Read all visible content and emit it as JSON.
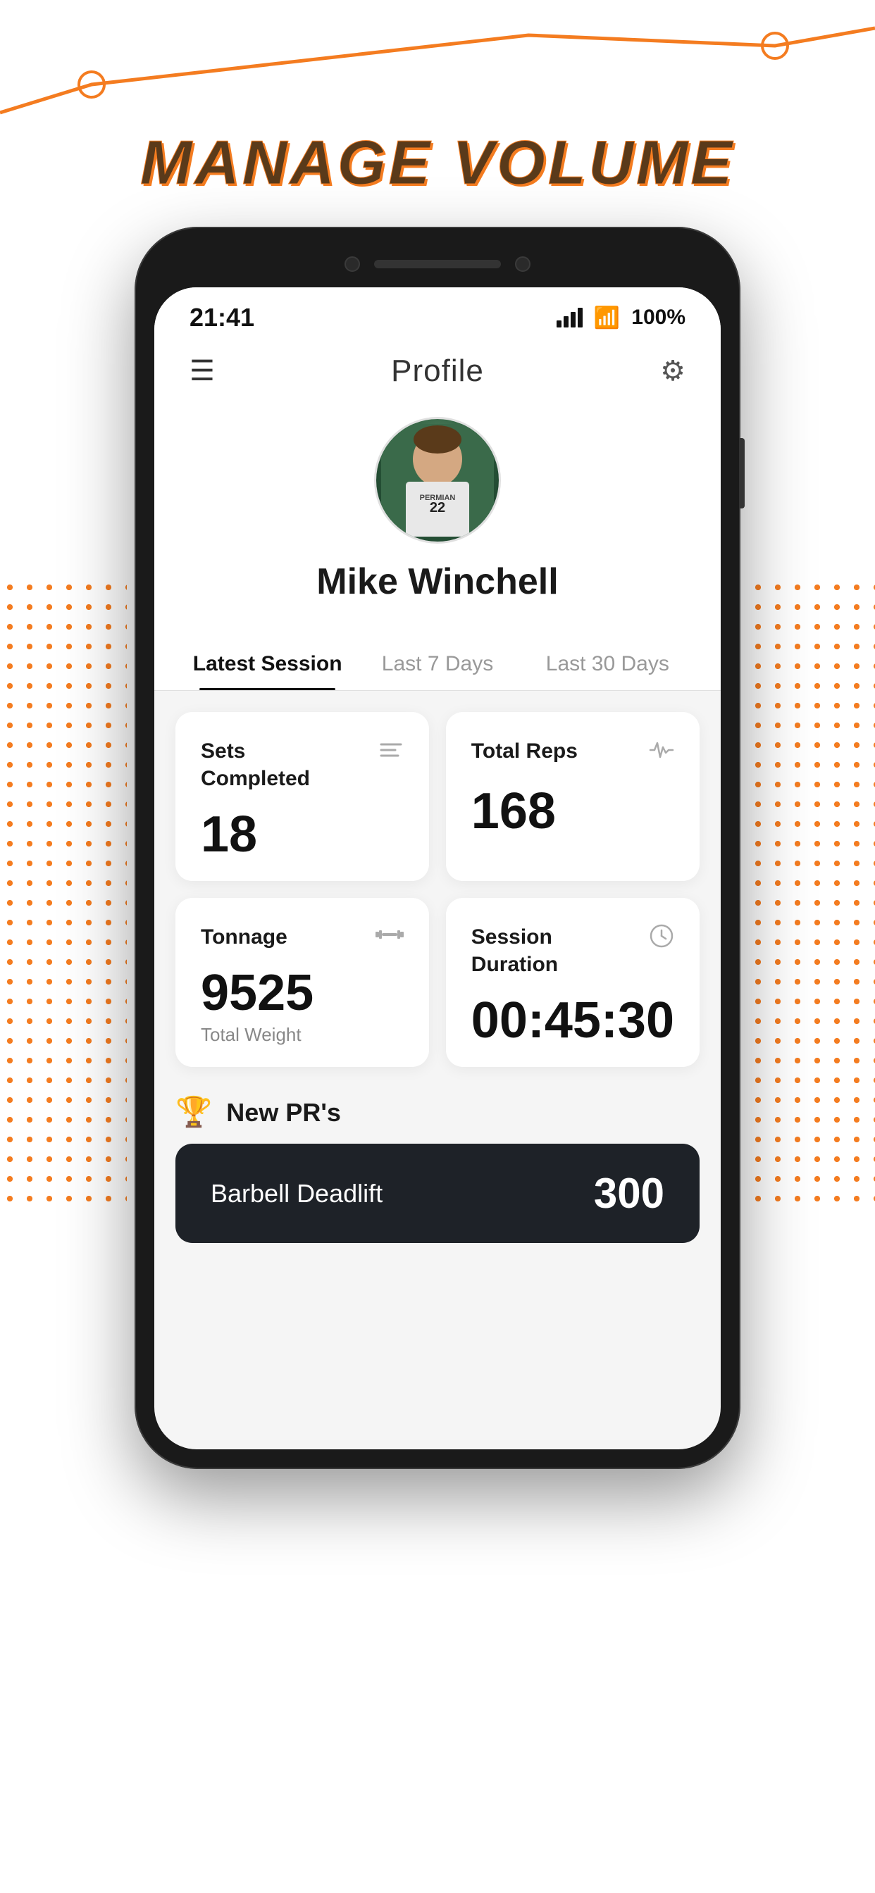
{
  "page": {
    "title": "MANAGE VOLUME"
  },
  "status_bar": {
    "time": "21:41",
    "battery": "100%"
  },
  "header": {
    "title": "Profile"
  },
  "profile": {
    "name": "Mike Winchell"
  },
  "tabs": [
    {
      "id": "latest",
      "label": "Latest Session",
      "active": true
    },
    {
      "id": "7days",
      "label": "Last 7 Days",
      "active": false
    },
    {
      "id": "30days",
      "label": "Last 30 Days",
      "active": false
    }
  ],
  "stats": [
    {
      "id": "sets",
      "label": "Sets Completed",
      "value": "18",
      "sublabel": "",
      "icon": "list-icon"
    },
    {
      "id": "reps",
      "label": "Total Reps",
      "value": "168",
      "sublabel": "",
      "icon": "activity-icon"
    },
    {
      "id": "tonnage",
      "label": "Tonnage",
      "value": "9525",
      "sublabel": "Total Weight",
      "icon": "barbell-icon"
    },
    {
      "id": "duration",
      "label": "Session Duration",
      "value": "00:45:30",
      "sublabel": "",
      "icon": "clock-icon"
    }
  ],
  "prs": {
    "section_title": "New PR's",
    "items": [
      {
        "exercise": "Barbell Deadlift",
        "value": "300"
      }
    ]
  },
  "colors": {
    "orange": "#f47c20",
    "dark": "#1e2228"
  }
}
